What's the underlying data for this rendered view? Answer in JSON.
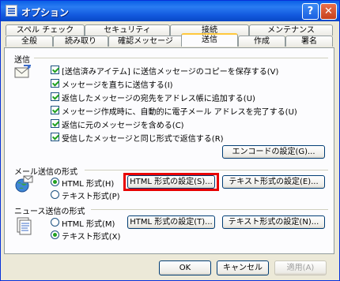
{
  "window": {
    "title": "オプション",
    "help_label": "?",
    "close_label": "✕"
  },
  "tabs_top": [
    "スペル チェック",
    "セキュリティ",
    "接続",
    "メンテナンス"
  ],
  "tabs_bottom": [
    "全般",
    "読み取り",
    "確認メッセージ",
    "送信",
    "作成",
    "署名"
  ],
  "active_tab": "送信",
  "send": {
    "label": "送信",
    "options": [
      {
        "label": "[送信済みアイテム] に送信メッセージのコピーを保存する(V)",
        "checked": true
      },
      {
        "label": "メッセージを直ちに送信する(I)",
        "checked": true
      },
      {
        "label": "返信したメッセージの宛先をアドレス帳に追加する(U)",
        "checked": true
      },
      {
        "label": "メッセージ作成時に、自動的に電子メール アドレスを完了する(U)",
        "checked": true
      },
      {
        "label": "返信に元のメッセージを含める(C)",
        "checked": true
      },
      {
        "label": "受信したメッセージと同じ形式で返信する(R)",
        "checked": true
      }
    ],
    "encode_button": "エンコードの設定(G)..."
  },
  "mail_format": {
    "label": "メール送信の形式",
    "html_label": "HTML 形式(H)",
    "text_label": "テキスト形式(P)",
    "selected": "html",
    "html_settings_button": "HTML 形式の設定(S)...",
    "text_settings_button": "テキスト形式の設定(E)..."
  },
  "news_format": {
    "label": "ニュース送信の形式",
    "html_label": "HTML 形式(M)",
    "text_label": "テキスト形式(X)",
    "selected": "text",
    "html_settings_button": "HTML 形式の設定(T)...",
    "text_settings_button": "テキスト形式の設定(N)..."
  },
  "footer": {
    "ok": "OK",
    "cancel": "キャンセル",
    "apply": "適用(A)"
  },
  "colors": {
    "highlight": "#e80000",
    "titlebar": "#0a5fe6",
    "active_tab_accent": "#ffc83c"
  }
}
